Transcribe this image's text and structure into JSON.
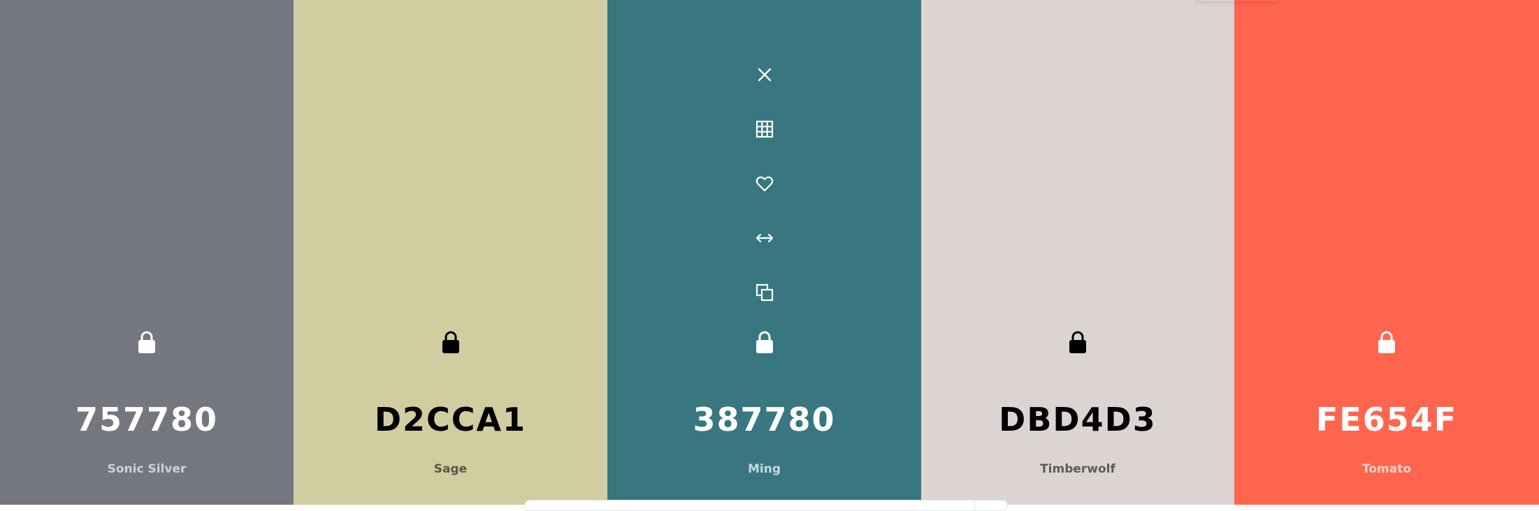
{
  "palette": [
    {
      "hex": "757780",
      "name": "Sonic Silver",
      "bg": "#757780",
      "text_color": "#ffffff",
      "name_color": "#cfd0d4",
      "lock_icon": "lock-icon"
    },
    {
      "hex": "D2CCA1",
      "name": "Sage",
      "bg": "#d2cca1",
      "text_color": "#000000",
      "name_color": "#5b5846",
      "lock_icon": "lock-icon"
    },
    {
      "hex": "387780",
      "name": "Ming",
      "bg": "#387780",
      "text_color": "#ffffff",
      "name_color": "#c5d9dc",
      "lock_icon": "lock-icon",
      "tools": [
        "close-icon",
        "grid-icon",
        "heart-icon",
        "arrows-horizontal-icon",
        "copy-icon"
      ]
    },
    {
      "hex": "DBD4D3",
      "name": "Timberwolf",
      "bg": "#dbd4d3",
      "text_color": "#000000",
      "name_color": "#5f5b5a",
      "lock_icon": "lock-icon"
    },
    {
      "hex": "FE654F",
      "name": "Tomato",
      "bg": "#fe654f",
      "text_color": "#ffffff",
      "name_color": "#ffd2cb",
      "lock_icon": "lock-icon"
    }
  ]
}
